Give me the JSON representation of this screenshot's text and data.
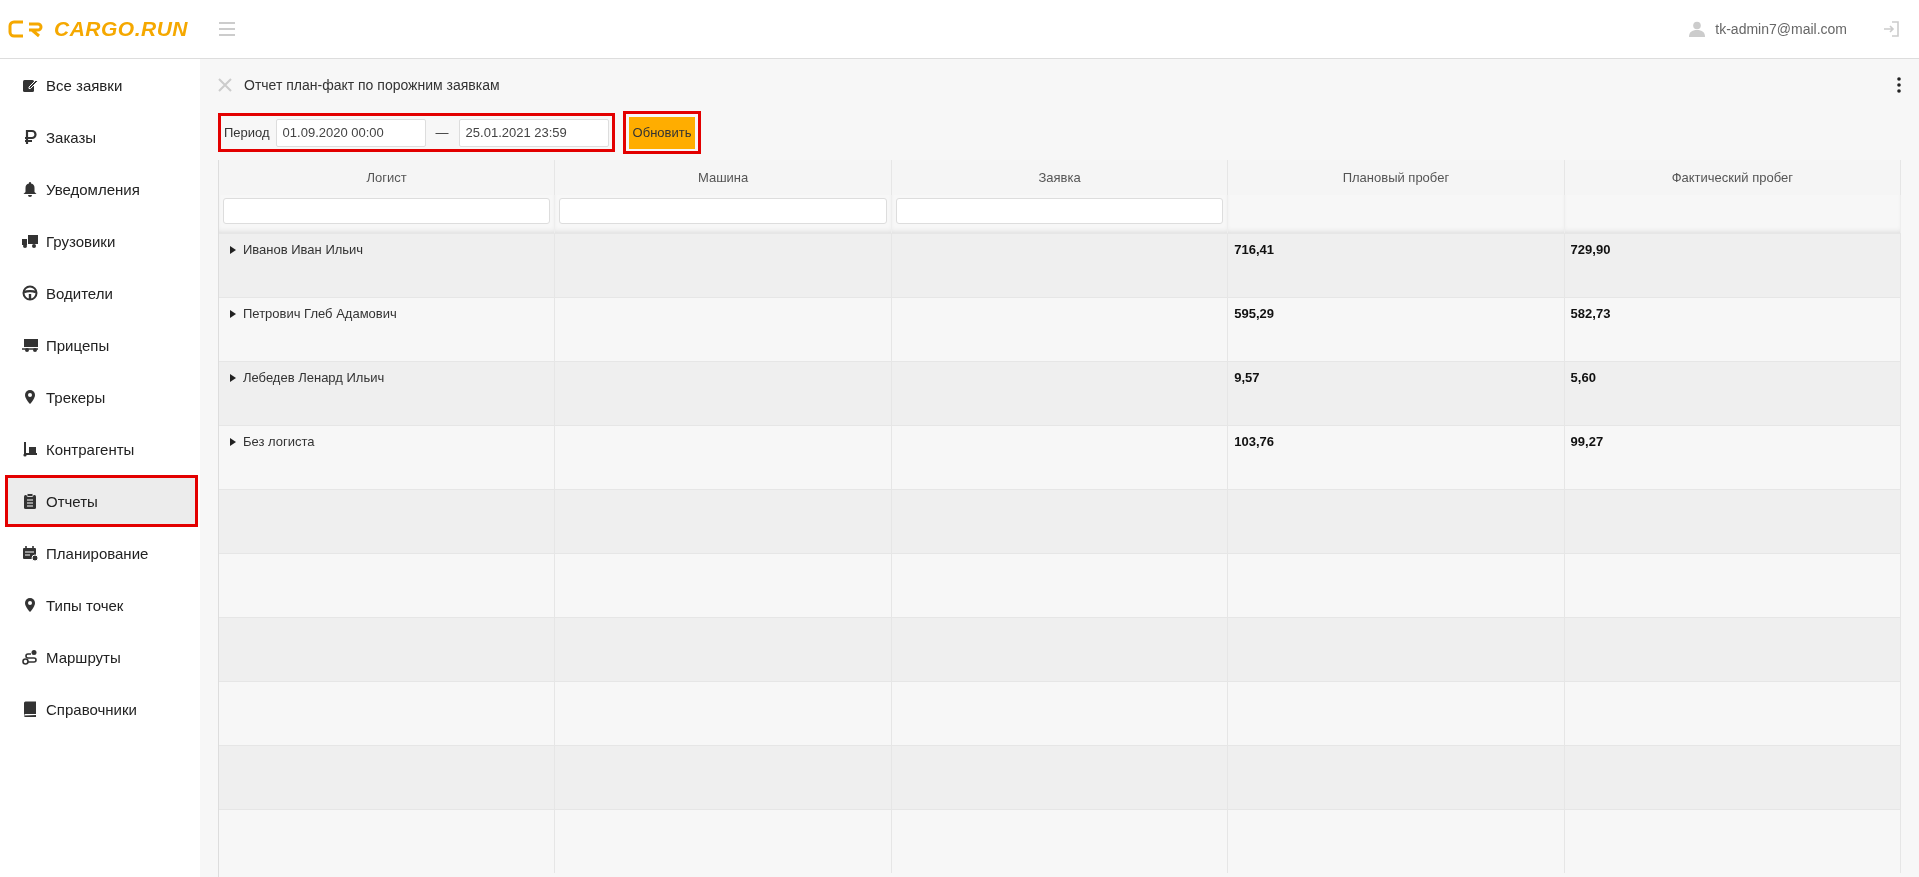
{
  "header": {
    "logo": "CARGO.RUN",
    "user": "tk-admin7@mail.com"
  },
  "sidebar": {
    "items": [
      {
        "label": "Все заявки",
        "selected": false,
        "highlighted": false
      },
      {
        "label": "Заказы",
        "selected": false,
        "highlighted": false
      },
      {
        "label": "Уведомления",
        "selected": false,
        "highlighted": false
      },
      {
        "label": "Грузовики",
        "selected": false,
        "highlighted": false
      },
      {
        "label": "Водители",
        "selected": false,
        "highlighted": false
      },
      {
        "label": "Прицепы",
        "selected": false,
        "highlighted": false
      },
      {
        "label": "Трекеры",
        "selected": false,
        "highlighted": false
      },
      {
        "label": "Контрагенты",
        "selected": false,
        "highlighted": false
      },
      {
        "label": "Отчеты",
        "selected": true,
        "highlighted": true
      },
      {
        "label": "Планирование",
        "selected": false,
        "highlighted": false
      },
      {
        "label": "Типы точек",
        "selected": false,
        "highlighted": false
      },
      {
        "label": "Маршруты",
        "selected": false,
        "highlighted": false
      },
      {
        "label": "Справочники",
        "selected": false,
        "highlighted": false
      }
    ]
  },
  "report": {
    "title": "Отчет план-факт по порожним заявкам",
    "period": {
      "label": "Период",
      "from": "01.09.2020 00:00",
      "separator": "—",
      "to": "25.01.2021 23:59",
      "highlighted": true
    },
    "refresh_button": {
      "label": "Обновить",
      "highlighted": true
    },
    "table": {
      "columns": [
        {
          "label": "Логист",
          "filterable": true
        },
        {
          "label": "Машина",
          "filterable": true
        },
        {
          "label": "Заявка",
          "filterable": true
        },
        {
          "label": "Плановый пробег",
          "filterable": false
        },
        {
          "label": "Фактический пробег",
          "filterable": false
        }
      ],
      "rows": [
        {
          "logist": "Иванов Иван Ильич",
          "expanded": false,
          "planned": "716,41",
          "actual": "729,90"
        },
        {
          "logist": "Петрович Глеб Адамович",
          "expanded": false,
          "planned": "595,29",
          "actual": "582,73"
        },
        {
          "logist": "Лебедев Ленард Ильич",
          "expanded": false,
          "planned": "9,57",
          "actual": "5,60"
        },
        {
          "logist": "Без логиста",
          "expanded": false,
          "planned": "103,76",
          "actual": "99,27"
        }
      ]
    }
  }
}
